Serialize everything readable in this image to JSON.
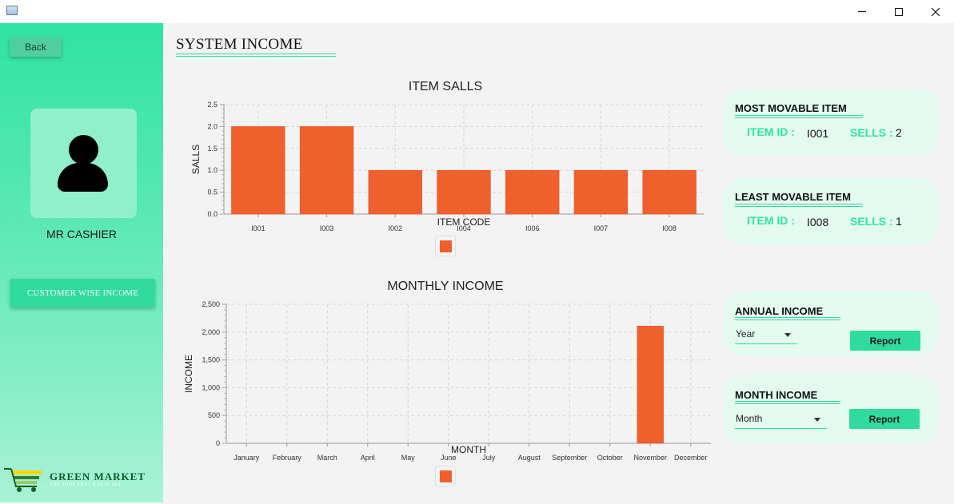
{
  "sidebar": {
    "back_label": "Back",
    "user_name": "MR CASHIER",
    "customer_income_label": "CUSTOMER WISE INCOME",
    "logo_title": "GREEN MARKET",
    "logo_tagline": "THE SHOP THAT HAS IT ALL"
  },
  "header": {
    "title": "SYSTEM INCOME"
  },
  "item_chart": {
    "title": "ITEM SALLS",
    "xlabel": "ITEM CODE",
    "ylabel": "SALLS"
  },
  "income_chart": {
    "title": "MONTHLY INCOME",
    "xlabel": "MONTH",
    "ylabel": "INCOME"
  },
  "chart_data": [
    {
      "type": "bar",
      "title": "ITEM SALLS",
      "xlabel": "ITEM CODE",
      "ylabel": "SALLS",
      "categories": [
        "I001",
        "I003",
        "I002",
        "I004",
        "I006",
        "I007",
        "I008"
      ],
      "values": [
        2,
        2,
        1,
        1,
        1,
        1,
        1
      ],
      "ylim": [
        0,
        2.5
      ],
      "yticks": [
        "0.0",
        "0.5",
        "1.0",
        "1.5",
        "2.0",
        "2.5"
      ],
      "grid": true,
      "legend": "bottom",
      "color": "#f0602d"
    },
    {
      "type": "bar",
      "title": "MONTHLY INCOME",
      "xlabel": "MONTH",
      "ylabel": "INCOME",
      "categories": [
        "January",
        "February",
        "March",
        "April",
        "May",
        "June",
        "July",
        "August",
        "September",
        "October",
        "November",
        "December"
      ],
      "values": [
        0,
        0,
        0,
        0,
        0,
        0,
        0,
        0,
        0,
        0,
        2110,
        0
      ],
      "ylim": [
        0,
        2500
      ],
      "yticks": [
        "0",
        "500",
        "1,000",
        "1,500",
        "2,000",
        "2,500"
      ],
      "grid": true,
      "legend": "bottom",
      "color": "#f0602d"
    }
  ],
  "most_movable": {
    "title": "MOST MOVABLE ITEM",
    "item_id_label": "ITEM ID :",
    "item_id": "I001",
    "sells_label": "SELLS :",
    "sells": "2"
  },
  "least_movable": {
    "title": "LEAST MOVABLE ITEM",
    "item_id_label": "ITEM ID :",
    "item_id": "I008",
    "sells_label": "SELLS :",
    "sells": "1"
  },
  "annual_income": {
    "title": "ANNUAL INCOME",
    "select_value": "Year",
    "report_label": "Report"
  },
  "month_income": {
    "title": "MONTH INCOME",
    "select_value": "Month",
    "report_label": "Report"
  },
  "colors": {
    "accent": "#30dba0",
    "bar": "#f0602d",
    "card": "#e3fbf0"
  }
}
